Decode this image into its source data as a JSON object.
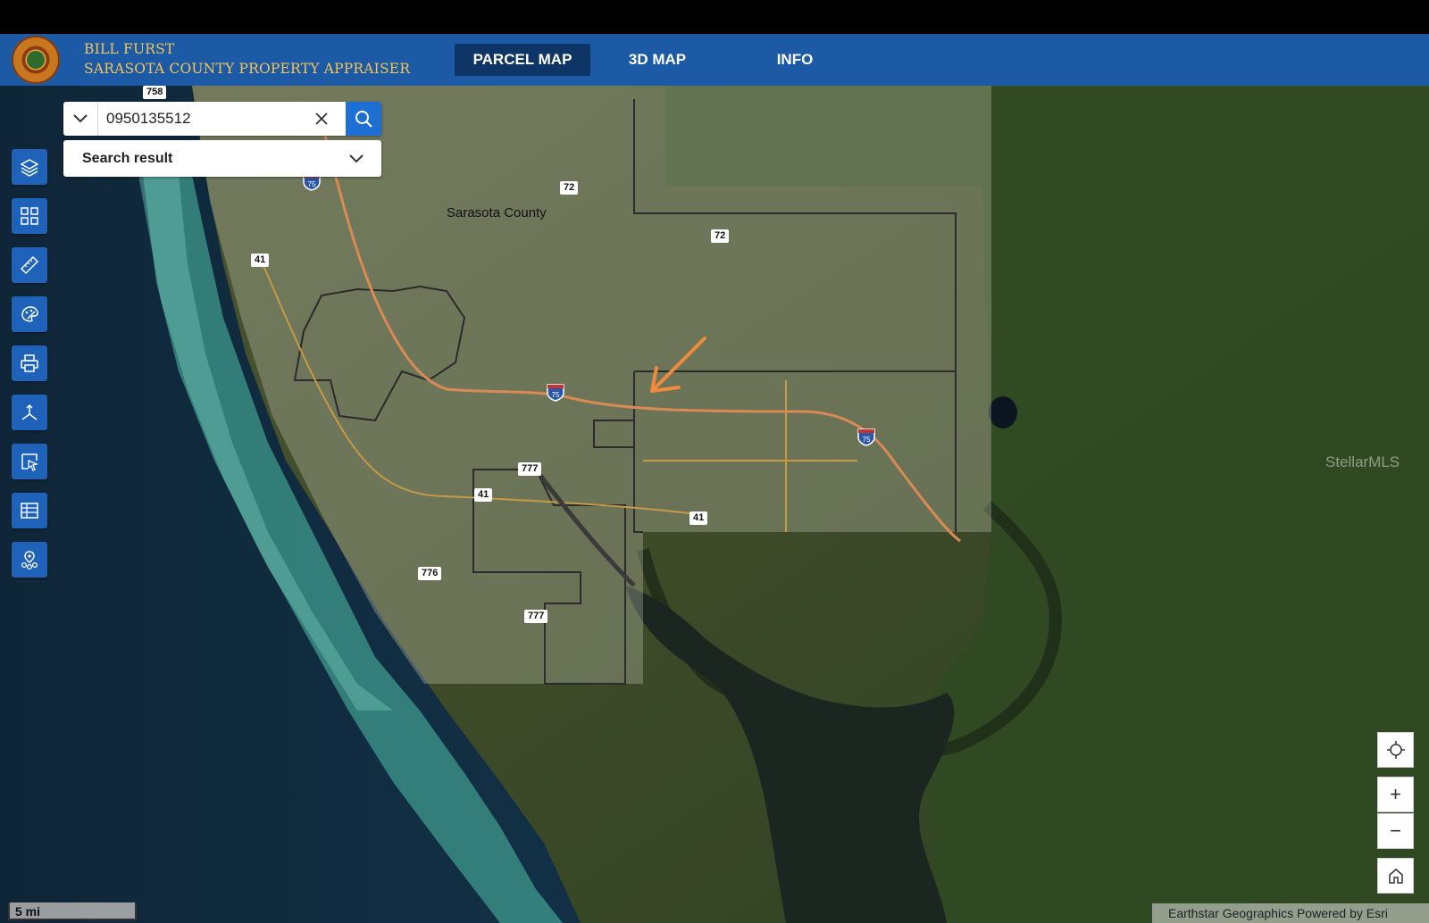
{
  "header": {
    "owner_name": "BILL FURST",
    "office_name": "SARASOTA COUNTY PROPERTY APPRAISER",
    "seal_icon": "county-seal",
    "tabs": [
      {
        "label": "PARCEL MAP",
        "active": true
      },
      {
        "label": "3D MAP",
        "active": false
      },
      {
        "label": "INFO",
        "active": false
      }
    ]
  },
  "search": {
    "value": "0950135512",
    "dropdown_icon": "chevron-down-icon",
    "clear_icon": "close-icon",
    "submit_icon": "search-icon"
  },
  "search_result": {
    "label": "Search result"
  },
  "toolbar": {
    "tools": [
      "layers-icon",
      "basemap-grid-icon",
      "measure-ruler-icon",
      "draw-icon",
      "print-icon",
      "coordinate-icon",
      "select-icon",
      "table-icon",
      "location-pins-icon"
    ]
  },
  "map": {
    "place_label": "Sarasota County",
    "route_shields": [
      "758",
      "75",
      "72",
      "72",
      "41",
      "75",
      "75",
      "777",
      "41",
      "41",
      "776",
      "777"
    ],
    "watermark": "StellarMLS",
    "scale_label": "5 mi",
    "attribution": "Earthstar Geographics  Powered by Esri"
  },
  "zoom_controls": {
    "locate_icon": "locate-icon",
    "zoom_in": "+",
    "zoom_out": "−",
    "home_icon": "home-icon"
  },
  "colors": {
    "header": "#1c5aa6",
    "active_tab": "#0f3466",
    "search_button": "#1d6fd3",
    "tool_button": "#1e63b9",
    "brand_text": "#f1c55a",
    "highway": "#d98a55",
    "arrow": "#f08a3c"
  }
}
